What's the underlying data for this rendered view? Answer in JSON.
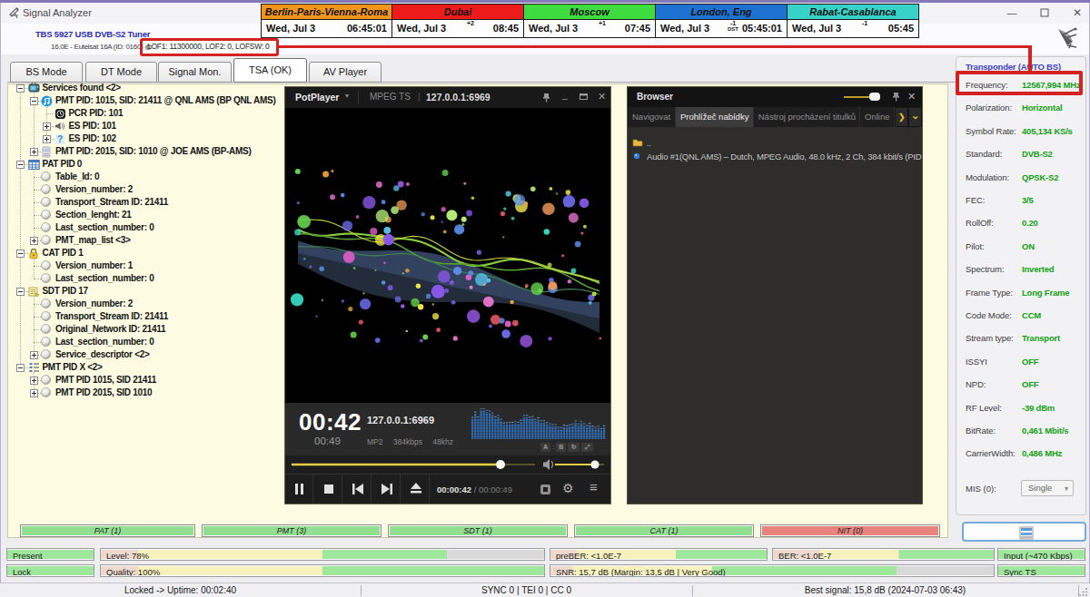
{
  "window": {
    "title": "Signal Analyzer",
    "minimize": "—",
    "maximize": "❐",
    "close": "✕"
  },
  "device": {
    "name": "TBS 5927 USB DVB-S2 Tuner",
    "satellite": "16.0E - Eutelsat 16A (ID: 0160) @",
    "lof": "LOF1: 11300000, LOF2: 0, LOFSW: 0"
  },
  "clocks": [
    {
      "city": "Berlin-Paris-Vienna-Roma",
      "color": "#f2951d",
      "date": "Wed, Jul 3",
      "offset": "",
      "dst": "",
      "time": "06:45:01"
    },
    {
      "city": "Dubai",
      "color": "#ee1b1b",
      "date": "Wed, Jul 3",
      "offset": "+2",
      "dst": "",
      "time": "08:45"
    },
    {
      "city": "Moscow",
      "color": "#3edc3e",
      "date": "Wed, Jul 3",
      "offset": "+1",
      "dst": "",
      "time": "07:45"
    },
    {
      "city": "London, Eng",
      "color": "#1e73d2",
      "date": "Wed, Jul 3",
      "offset": "-1",
      "dst": "DST",
      "time": "05:45:01"
    },
    {
      "city": "Rabat-Casablanca",
      "color": "#38d3c8",
      "date": "Wed, Jul 3",
      "offset": "-1",
      "dst": "",
      "time": "05:45"
    }
  ],
  "tabs": [
    {
      "label": "BS Mode",
      "selected": false
    },
    {
      "label": "DT Mode",
      "selected": false
    },
    {
      "label": "Signal Mon.",
      "selected": false
    },
    {
      "label": "TSA (OK)",
      "selected": true
    },
    {
      "label": "AV Player",
      "selected": false
    }
  ],
  "tree": [
    {
      "level": 0,
      "expand": "-",
      "icon": "services-icon",
      "text": "Services found <2>"
    },
    {
      "level": 1,
      "expand": "-",
      "icon": "music-icon",
      "text": "PMT PID: 1015, SID: 21411 @ QNL AMS (BP QNL AMS)"
    },
    {
      "level": 2,
      "expand": "",
      "icon": "pcr-icon",
      "text": "PCR PID: 101"
    },
    {
      "level": 2,
      "expand": "+",
      "icon": "speaker-icon",
      "text": "ES PID: 101"
    },
    {
      "level": 2,
      "expand": "+",
      "icon": "question-icon",
      "text": "ES PID: 102"
    },
    {
      "level": 1,
      "expand": "+",
      "icon": "tv-icon",
      "text": "PMT PID: 2015, SID: 1010 @ JOE AMS (BP-AMS)"
    },
    {
      "level": 0,
      "expand": "-",
      "icon": "table-icon",
      "text": "PAT PID 0"
    },
    {
      "level": 1,
      "expand": "",
      "icon": "sphere-icon",
      "text": "Table_Id: 0"
    },
    {
      "level": 1,
      "expand": "",
      "icon": "sphere-icon",
      "text": "Version_number: 2"
    },
    {
      "level": 1,
      "expand": "",
      "icon": "sphere-icon",
      "text": "Transport_Stream ID: 21411"
    },
    {
      "level": 1,
      "expand": "",
      "icon": "sphere-icon",
      "text": "Section_lenght: 21"
    },
    {
      "level": 1,
      "expand": "",
      "icon": "sphere-icon",
      "text": "Last_section_number: 0"
    },
    {
      "level": 1,
      "expand": "+",
      "icon": "sphere-icon",
      "text": "PMT_map_list <3>"
    },
    {
      "level": 0,
      "expand": "-",
      "icon": "lock-icon",
      "text": "CAT PID 1"
    },
    {
      "level": 1,
      "expand": "",
      "icon": "sphere-icon",
      "text": "Version_number: 1"
    },
    {
      "level": 1,
      "expand": "",
      "icon": "sphere-icon",
      "text": "Last_section_number: 0"
    },
    {
      "level": 0,
      "expand": "-",
      "icon": "sdt-icon",
      "text": "SDT PID 17"
    },
    {
      "level": 1,
      "expand": "",
      "icon": "sphere-icon",
      "text": "Version_number: 2"
    },
    {
      "level": 1,
      "expand": "",
      "icon": "sphere-icon",
      "text": "Transport_Stream ID: 21411"
    },
    {
      "level": 1,
      "expand": "",
      "icon": "sphere-icon",
      "text": "Original_Network ID: 21411"
    },
    {
      "level": 1,
      "expand": "",
      "icon": "sphere-icon",
      "text": "Last_section_number: 0"
    },
    {
      "level": 1,
      "expand": "+",
      "icon": "sphere-icon",
      "text": "Service_descriptor <2>"
    },
    {
      "level": 0,
      "expand": "-",
      "icon": "pmtlist-icon",
      "text": "PMT PID X <2>"
    },
    {
      "level": 1,
      "expand": "+",
      "icon": "sphere-icon",
      "text": "PMT PID 1015, SID 21411"
    },
    {
      "level": 1,
      "expand": "+",
      "icon": "sphere-icon",
      "text": "PMT PID 2015, SID 1010"
    }
  ],
  "player": {
    "app_name": "PotPlayer",
    "format": "MPEG TS",
    "source": "127.0.0.1:6969",
    "time_big": "00:42",
    "time_small": "00:49",
    "stream_title": "127.0.0.1:6969",
    "codec_info": "MP2 384kbps 48khz",
    "position": "00:00:42",
    "duration": "00:00:49",
    "duration_sep": " / ",
    "seek_pct": 85.7,
    "volume_pct": 82,
    "menu_icon": "≡",
    "gear_icon": "⚙"
  },
  "browser": {
    "title": "Browser",
    "tabs": [
      {
        "label": "Navigovat",
        "active": false
      },
      {
        "label": "Prohlížeč nabídky",
        "active": true
      },
      {
        "label": "Nástroj procházení titulků",
        "active": false
      },
      {
        "label": "Online",
        "active": false
      }
    ],
    "arrow_right": "❯",
    "arrow_down": "❮",
    "items": [
      {
        "icon": "folder-icon",
        "text": ".."
      },
      {
        "icon": "audio-dot-icon",
        "text": "Audio #1(QNL AMS) – Dutch, MPEG Audio, 48.0 kHz, 2 Ch, 384 kbit/s (PID..."
      }
    ]
  },
  "transponder": {
    "title": "Transponder (AUTO BS)",
    "rows": [
      {
        "label": "Frequency:",
        "value": "12567,994 MHz"
      },
      {
        "label": "Polarization:",
        "value": "Horizontal"
      },
      {
        "label": "Symbol Rate:",
        "value": "405,134 KS/s"
      },
      {
        "label": "Standard:",
        "value": "DVB-S2"
      },
      {
        "label": "Modulation:",
        "value": "QPSK-S2"
      },
      {
        "label": "FEC:",
        "value": "3/5"
      },
      {
        "label": "RollOff:",
        "value": "0.20"
      },
      {
        "label": "Pilot:",
        "value": "ON"
      },
      {
        "label": "Spectrum:",
        "value": "Inverted"
      },
      {
        "label": "Frame Type:",
        "value": "Long Frame"
      },
      {
        "label": "Code Mode:",
        "value": "CCM"
      },
      {
        "label": "Stream type:",
        "value": "Transport"
      },
      {
        "label": "ISSYI",
        "value": "OFF"
      },
      {
        "label": "NPD:",
        "value": "OFF"
      },
      {
        "label": "RF Level:",
        "value": "-39 dBm"
      },
      {
        "label": "BitRate:",
        "value": "0,461 Mbit/s"
      },
      {
        "label": "CarrierWidth:",
        "value": "0,486 MHz"
      }
    ],
    "mis_label": "MIS (0):",
    "mis_value": "Single"
  },
  "psi_bars": [
    {
      "label": "PAT (1)",
      "color": "#92df92"
    },
    {
      "label": "PMT (3)",
      "color": "#92df92"
    },
    {
      "label": "SDT (1)",
      "color": "#92df92"
    },
    {
      "label": "CAT (1)",
      "color": "#92df92"
    },
    {
      "label": "NIT (0)",
      "color": "#e9837d"
    }
  ],
  "signal": {
    "present": "Present",
    "lock": "Lock",
    "level": "Level: 78%",
    "quality": "Quality: 100%",
    "preber": "preBER: <1.0E-7",
    "snr": "SNR: 15,7 dB (Margin: 13,5 dB | Very Good)",
    "ber": "BER: <1.0E-7",
    "input": "Input (~470 Kbps)",
    "sync": "Sync TS"
  },
  "statusbar": {
    "uptime": "Locked -> Uptime: 00:02:40",
    "counters": "SYNC 0 | TEI 0 | CC 0",
    "best": "Best signal: 15,8 dB (2024-07-03 06:43)"
  },
  "colors": {
    "annotation_red": "#d42222",
    "value_green": "#14a014",
    "bar_green": "#9fe79c",
    "bar_yellow": "#f6f1bd",
    "bar_pink": "#eed9ce",
    "bar_gray": "#d9d9d9",
    "psi_green": "#92df92",
    "psi_red": "#e9837d"
  }
}
